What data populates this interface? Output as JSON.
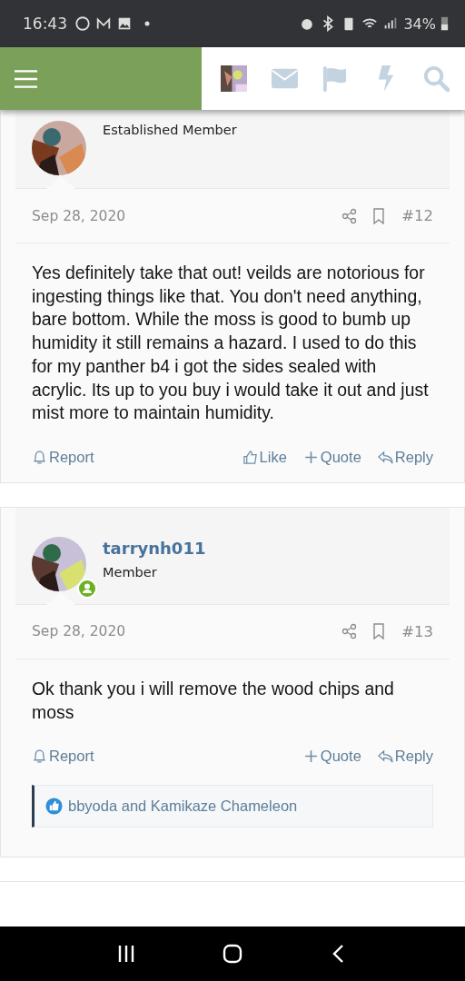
{
  "status_bar": {
    "time": "16:43",
    "battery": "34%"
  },
  "posts": [
    {
      "role": "Established Member",
      "online": false,
      "date": "Sep 28, 2020",
      "number": "#12",
      "body": "Yes definitely take that out! veilds are notorious for ingesting things like that. You don't need anything, bare bottom. While the moss is good to bumb up humidity it still remains a hazard. I used to do this for my panther b4 i got the sides sealed with acrylic. Its up to you buy i would take it out and just mist more to maintain humidity.",
      "actions": [
        {
          "kind": "report",
          "label": "Report"
        },
        {
          "kind": "like",
          "label": "Like"
        },
        {
          "kind": "quote",
          "label": "Quote"
        },
        {
          "kind": "reply",
          "label": "Reply"
        }
      ]
    },
    {
      "username": "tarrynh011",
      "role": "Member",
      "online": true,
      "date": "Sep 28, 2020",
      "number": "#13",
      "body": "Ok thank you i will remove the wood chips and moss",
      "actions": [
        {
          "kind": "report",
          "label": "Report"
        },
        {
          "kind": "quote",
          "label": "Quote"
        },
        {
          "kind": "reply",
          "label": "Reply"
        }
      ],
      "reactions": "bbyoda and Kamikaze Chameleon"
    }
  ]
}
